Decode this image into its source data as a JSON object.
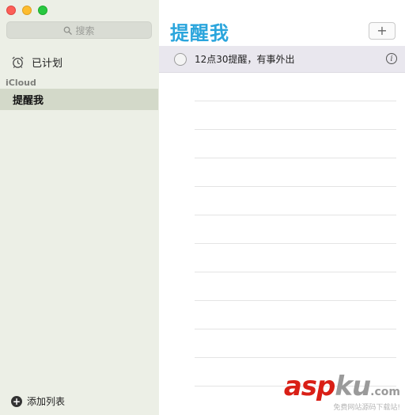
{
  "window": {
    "title": "提醒我"
  },
  "sidebar": {
    "search_placeholder": "搜索",
    "scheduled_label": "已计划",
    "section_label": "iCloud",
    "lists": [
      {
        "label": "提醒我",
        "selected": true
      }
    ],
    "add_list_label": "添加列表"
  },
  "main": {
    "title": "提醒我",
    "add_button_label": "+",
    "reminders": [
      {
        "text": "12点30提醒，有事外出",
        "completed": false
      }
    ]
  },
  "watermark": {
    "brand_a": "asp",
    "brand_b": "ku",
    "brand_c": ".com",
    "subtitle": "免费网站源码下载站!"
  },
  "colors": {
    "accent": "#2aa5dc",
    "sidebar_bg": "#ecefe6",
    "selected_bg": "#d3d9c9",
    "row_bg": "#e9e7ee",
    "watermark_red": "#d91f16"
  }
}
